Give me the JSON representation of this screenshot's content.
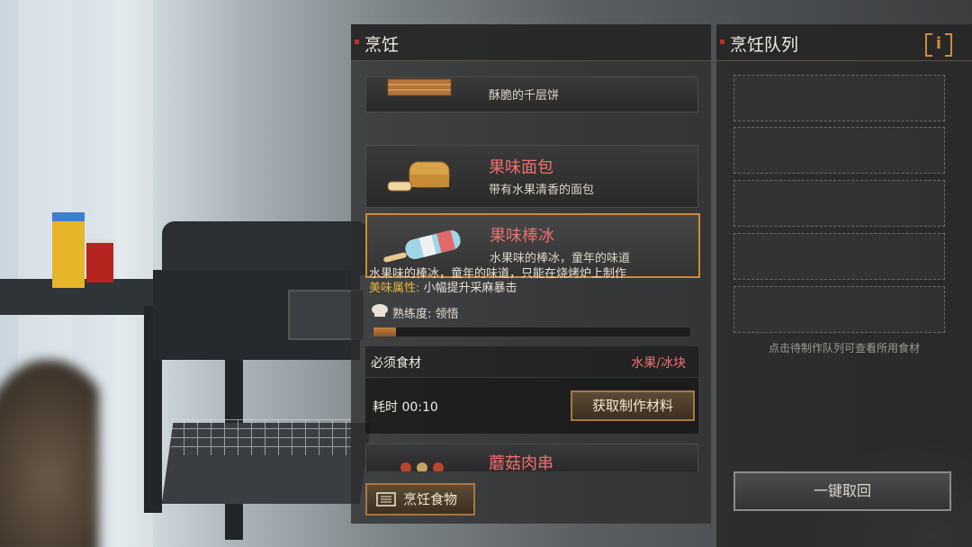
{
  "cooking": {
    "title": "烹饪",
    "recipes": [
      {
        "name": "",
        "desc": "酥脆的千层饼",
        "icon": "layered-pancake-icon"
      },
      {
        "name": "果味面包",
        "desc": "带有水果清香的面包",
        "icon": "bread-icon"
      },
      {
        "name": "果味棒冰",
        "desc": "水果味的棒冰，童年的味道",
        "icon": "popsicle-icon",
        "selected": true
      },
      {
        "name": "蘑菇肉串",
        "desc": "",
        "icon": "mushroom-skewer-icon"
      }
    ],
    "detail": {
      "description": "水果味的棒冰，童年的味道，只能在烧烤炉上制作",
      "attr_label": "美味属性:",
      "attr_value": "小幅提升采麻暴击",
      "proficiency": "熟练度: 领悟",
      "proficiency_progress": 0.07,
      "required_label": "必须食材",
      "required_value": "水果/冰块",
      "time": "耗时 00:10",
      "get_materials_button": "获取制作材料"
    },
    "cook_button": "烹饪食物"
  },
  "queue": {
    "title": "烹饪队列",
    "slots": 5,
    "hint": "点击待制作队列可查看所用食材",
    "cancel_all_button": "一键取回"
  },
  "colors": {
    "accent_orange": "#d08a3a",
    "recipe_name_red": "#ee6f6f",
    "attr_yellow": "#e6b83c",
    "marker_red": "#b9322d"
  }
}
